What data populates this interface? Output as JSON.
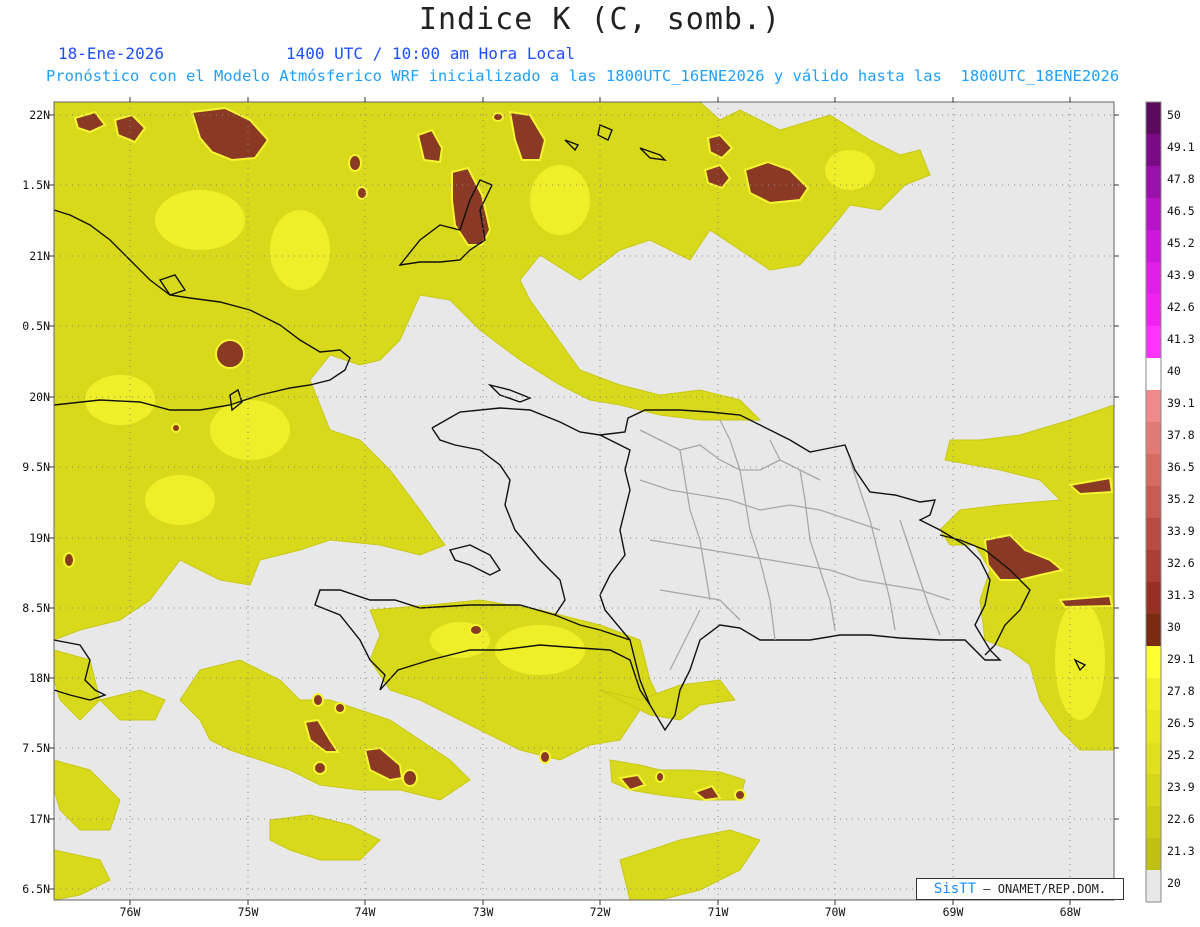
{
  "header": {
    "title": "Indice K (C, somb.)",
    "date": "18-Ene-2026",
    "time": "1400 UTC / 10:00 am Hora Local",
    "description": "Pronóstico con el Modelo Atmósferico WRF inicializado a las 1800UTC_16ENE2026 y válido hasta las  1800UTC_18ENE2026"
  },
  "axes": {
    "lat_labels": [
      "22N",
      "1.5N",
      "21N",
      "0.5N",
      "20N",
      "9.5N",
      "19N",
      "8.5N",
      "18N",
      "7.5N",
      "17N",
      "6.5N"
    ],
    "lon_labels": [
      "76W",
      "75W",
      "74W",
      "73W",
      "72W",
      "71W",
      "70W",
      "69W",
      "68W"
    ]
  },
  "colorbar": {
    "labels": [
      "50",
      "49.1",
      "47.8",
      "46.5",
      "45.2",
      "43.9",
      "42.6",
      "41.3",
      "40",
      "39.1",
      "37.8",
      "36.5",
      "35.2",
      "33.9",
      "32.6",
      "31.3",
      "30",
      "29.1",
      "27.8",
      "26.5",
      "25.2",
      "23.9",
      "22.6",
      "21.3",
      "20"
    ],
    "colors": [
      "#5c0a5e",
      "#7a0a86",
      "#9a10aa",
      "#b614c6",
      "#cc18d8",
      "#e01ee4",
      "#f022f0",
      "#ff33ff",
      "#ffffff",
      "#f08a8a",
      "#e07a74",
      "#d46c62",
      "#c85c52",
      "#b84c42",
      "#a83e34",
      "#963024",
      "#7a2a10",
      "#ffff33",
      "#f0f02a",
      "#e8e822",
      "#e0e01e",
      "#d6d61a",
      "#cccc16",
      "#c0c012",
      "#e8e8e8"
    ]
  },
  "credit": {
    "brand": "SisTT",
    "text": " – ONAMET/REP.DOM."
  },
  "colors": {
    "background": "#e8e8e8",
    "k_20_30": "#d8d81a",
    "k_30_plus": "#8a3a24",
    "coast": "#111111",
    "province": "#a0a0a0"
  }
}
